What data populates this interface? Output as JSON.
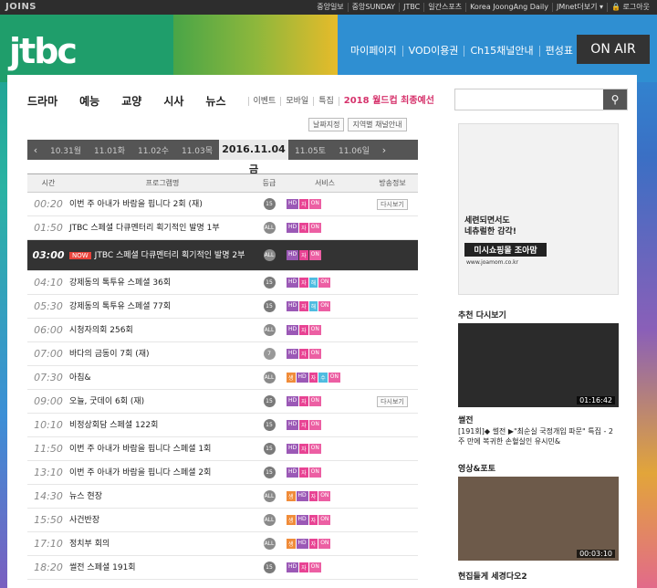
{
  "topbar": {
    "brand": "JOINS",
    "links": [
      "중앙일보",
      "중앙SUNDAY",
      "JTBC",
      "일간스포츠",
      "Korea JoongAng Daily",
      "JMnet더보기 ▾",
      "🔒 로그아웃"
    ]
  },
  "header": {
    "logo": "jtbc",
    "nav": [
      "마이페이지",
      "VOD이용권",
      "Ch15채널안내",
      "편성표"
    ],
    "onair": "ON AIR"
  },
  "gnb": {
    "main": [
      "드라마",
      "예능",
      "교양",
      "시사",
      "뉴스"
    ],
    "sub": [
      "이벤트",
      "모바일",
      "특집",
      "2018 월드컵 최종예선"
    ]
  },
  "search": {
    "placeholder": ""
  },
  "options": [
    "날짜지정",
    "지역별 채널안내"
  ],
  "datebar": {
    "dates": [
      "10.31월",
      "11.01화",
      "11.02수",
      "11.03목",
      "2016.11.04 금",
      "11.05토",
      "11.06일"
    ],
    "active_index": 4
  },
  "table": {
    "headers": [
      "시간",
      "프로그램명",
      "등급",
      "서비스",
      "방송정보"
    ],
    "rows": [
      {
        "time": "00:20",
        "title": "이번 주 아내가 바람을 핍니다 2회 (재)",
        "grade": "15",
        "services": [
          "HD",
          "자",
          "ON"
        ],
        "info": "다시보기"
      },
      {
        "time": "01:50",
        "title": "JTBC 스페셜 다큐멘터리 획기적인 발명 1부",
        "grade": "ALL",
        "services": [
          "HD",
          "자",
          "ON"
        ],
        "info": ""
      },
      {
        "time": "03:00",
        "title": "JTBC 스페셜 다큐멘터리 획기적인 발명 2부",
        "grade": "ALL",
        "services": [
          "HD",
          "자",
          "ON"
        ],
        "info": "",
        "now": "NOW"
      },
      {
        "time": "04:10",
        "title": "강제동의 톡투유 스페셜 36회",
        "grade": "15",
        "services": [
          "HD",
          "자",
          "해",
          "ON"
        ],
        "info": ""
      },
      {
        "time": "05:30",
        "title": "강제동의 톡투유 스페셜 77회",
        "grade": "15",
        "services": [
          "HD",
          "자",
          "해",
          "ON"
        ],
        "info": ""
      },
      {
        "time": "06:00",
        "title": "시청자의회 256회",
        "grade": "ALL",
        "services": [
          "HD",
          "자",
          "ON"
        ],
        "info": ""
      },
      {
        "time": "07:00",
        "title": "바다의 금동이 7회 (재)",
        "grade": "7",
        "services": [
          "HD",
          "자",
          "ON"
        ],
        "info": ""
      },
      {
        "time": "07:30",
        "title": "아침&",
        "grade": "ALL",
        "services": [
          "생",
          "HD",
          "자",
          "수",
          "ON"
        ],
        "info": ""
      },
      {
        "time": "09:00",
        "title": "오늘, 굿데이 6회 (재)",
        "grade": "15",
        "services": [
          "HD",
          "자",
          "ON"
        ],
        "info": "다시보기"
      },
      {
        "time": "10:10",
        "title": "비정상회담 스페셜 122회",
        "grade": "15",
        "services": [
          "HD",
          "자",
          "ON"
        ],
        "info": ""
      },
      {
        "time": "11:50",
        "title": "이번 주 아내가 바람을 핍니다 스페셜 1회",
        "grade": "15",
        "services": [
          "HD",
          "자",
          "ON"
        ],
        "info": ""
      },
      {
        "time": "13:10",
        "title": "이번 주 아내가 바람을 핍니다 스페셜 2회",
        "grade": "15",
        "services": [
          "HD",
          "자",
          "ON"
        ],
        "info": ""
      },
      {
        "time": "14:30",
        "title": "뉴스 현장",
        "grade": "ALL",
        "services": [
          "생",
          "HD",
          "자",
          "ON"
        ],
        "info": ""
      },
      {
        "time": "15:50",
        "title": "사건반장",
        "grade": "ALL",
        "services": [
          "생",
          "HD",
          "자",
          "ON"
        ],
        "info": ""
      },
      {
        "time": "17:10",
        "title": "정치부 회의",
        "grade": "ALL",
        "services": [
          "생",
          "HD",
          "자",
          "ON"
        ],
        "info": ""
      },
      {
        "time": "18:20",
        "title": "썰전 스페셜 191회",
        "grade": "15",
        "services": [
          "HD",
          "자",
          "ON"
        ],
        "info": ""
      }
    ]
  },
  "ad": {
    "line1": "세련되면서도",
    "line2": "네츄럴한 감각!",
    "shop": "미시쇼핑몰 조아맘",
    "url": "www.joamom.co.kr"
  },
  "rec": {
    "title": "추천 다시보기",
    "duration": "01:16:42",
    "show": "썰전",
    "desc": "[191회]◆ 썰전 ▶\"최순실 국정개입 파문\" 특집 - 2주 만에 복귀한 손혈실인 유시민&"
  },
  "video": {
    "title": "영상&포토",
    "duration": "00:03:10",
    "caption": "현집들게 세경다오2"
  },
  "colors": {
    "accent": "#e8433b",
    "hd": "#9b59b6",
    "ja": "#e84393",
    "on": "#ec5fa3"
  }
}
